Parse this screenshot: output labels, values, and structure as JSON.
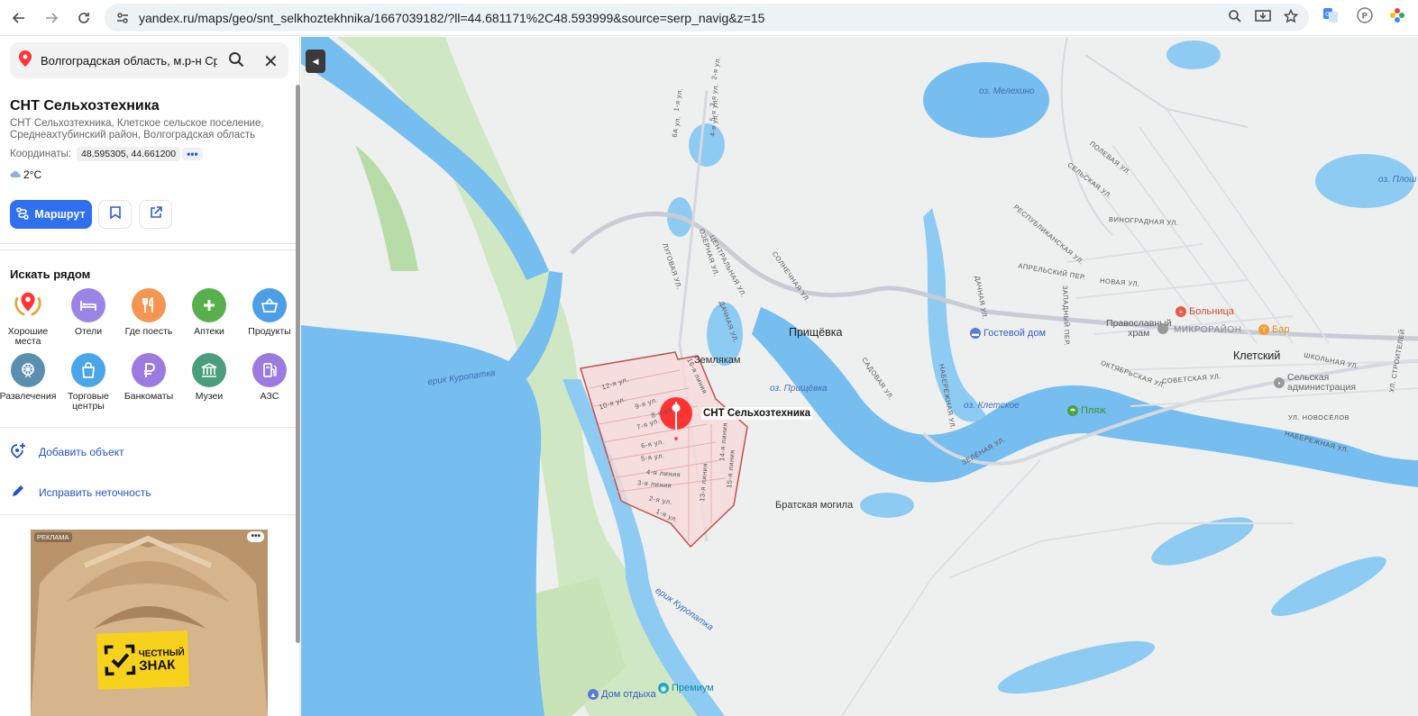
{
  "browser": {
    "url": "yandex.ru/maps/geo/snt_selkhoztekhnika/1667039182/?ll=44.681171%2C48.593999&source=serp_navig&z=15"
  },
  "search": {
    "query": "Волгоградская область, м.р-н Среднеахтубинский"
  },
  "place": {
    "title": "СНТ Сельхозтехника",
    "address": "СНТ Сельхозтехника, Клетское сельское поселение, Среднеахтубинский район, Волгоградская область",
    "coords_label": "Координаты:",
    "coords_value": "48.595305, 44.661200",
    "coords_more": "•••",
    "weather": "2°C"
  },
  "actions": {
    "route": "Маршрут",
    "add_object": "Добавить объект",
    "fix_error": "Исправить неточность"
  },
  "nearby": {
    "title": "Искать рядом",
    "items": [
      {
        "label": "Хорошие места",
        "icon": "good-places-icon",
        "color": "#ffffff"
      },
      {
        "label": "Отели",
        "icon": "hotel-icon",
        "color": "#9b84e6"
      },
      {
        "label": "Где поесть",
        "icon": "food-icon",
        "color": "#f59552"
      },
      {
        "label": "Аптеки",
        "icon": "pharmacy-icon",
        "color": "#58b04c"
      },
      {
        "label": "Продукты",
        "icon": "groceries-icon",
        "color": "#4c9ee6"
      },
      {
        "label": "Развлечения",
        "icon": "entertainment-icon",
        "color": "#5b8fb0"
      },
      {
        "label": "Торговые центры",
        "icon": "mall-icon",
        "color": "#4aa6e8"
      },
      {
        "label": "Банкоматы",
        "icon": "atm-icon",
        "color": "#9b7be0"
      },
      {
        "label": "Музеи",
        "icon": "museum-icon",
        "color": "#4a9e7c"
      },
      {
        "label": "АЗС",
        "icon": "gas-station-icon",
        "color": "#9b7be0"
      }
    ]
  },
  "ad": {
    "tag": "РЕКЛАМА",
    "more": "•••",
    "brand_line1": "ЧЕСТНЫЙ",
    "brand_line2": "ЗНАК"
  },
  "map": {
    "marker_label": "СНТ Сельхозтехника",
    "towns": [
      {
        "name": "Прищёвка"
      },
      {
        "name": "Клетский"
      },
      {
        "name": "Землякам"
      },
      {
        "name": "Братская могила"
      }
    ],
    "water": [
      {
        "name": "оз. Мелехино"
      },
      {
        "name": "оз. Прищёвка"
      },
      {
        "name": "оз. Клетское"
      },
      {
        "name": "оз. Плош"
      },
      {
        "name": "ерик Куропатка"
      },
      {
        "name": "ерик Куропатка"
      }
    ],
    "pois": [
      {
        "name": "Гостевой дом",
        "color": "#5a79d8"
      },
      {
        "name": "Больница",
        "color": "#e85b4a"
      },
      {
        "name": "Бар",
        "color": "#f59a2e"
      },
      {
        "name": "Пляж",
        "color": "#45a43b"
      },
      {
        "name": "Православный храм",
        "color": "#999999"
      },
      {
        "name": "МИКРОРАЙОН",
        "color": "#999999"
      },
      {
        "name": "Сельская администрация",
        "color": "#999999"
      },
      {
        "name": "Дом отдыха",
        "color": "#5a79d8"
      },
      {
        "name": "Премиум",
        "color": "#1fa6c8"
      }
    ],
    "streets": [
      "ЦЕНТРАЛЬНАЯ УЛ.",
      "ОЗЁРНАЯ УЛ.",
      "ЛУГОВАЯ УЛ.",
      "СОЛНЕЧНАЯ УЛ.",
      "ДАЧНАЯ УЛ.",
      "САДОВАЯ УЛ.",
      "НАБЕРЕЖНАЯ УЛ.",
      "ЗЕЛЁНАЯ УЛ.",
      "ДАЧНАЯ УЛ.",
      "ЗАПАДНЫЙ ПЕР.",
      "АПРЕЛЬСКИЙ ПЕР.",
      "НОВАЯ УЛ.",
      "ВИНОГРАДНАЯ УЛ.",
      "РЕСПУБЛИКАНСКАЯ УЛ.",
      "СЕЛЬСКАЯ УЛ.",
      "ПОЛЕВАЯ УЛ.",
      "СОВЕТСКАЯ УЛ.",
      "ОКТЯБРЬСКАЯ УЛ.",
      "ШКОЛЬНАЯ УЛ.",
      "УЛ. НОВОСЁЛОВ",
      "НАБЕРЕЖНАЯ УЛ.",
      "УЛ. СТРОИТЕЛЕЙ",
      "12-я ул.",
      "16-я линия",
      "10-я ул.",
      "9-я ул.",
      "8-я ул.",
      "7-я ул.",
      "6-я ул.",
      "5-я ул.",
      "4-я линия",
      "3-я линия",
      "2-я ул.",
      "1-я ул.",
      "13-я линия",
      "14-я линия",
      "15-я линия",
      "1-я ул.",
      "2-я ул.",
      "3-я ул.",
      "4-я ул.",
      "5-я ул.",
      "6А ул."
    ]
  }
}
